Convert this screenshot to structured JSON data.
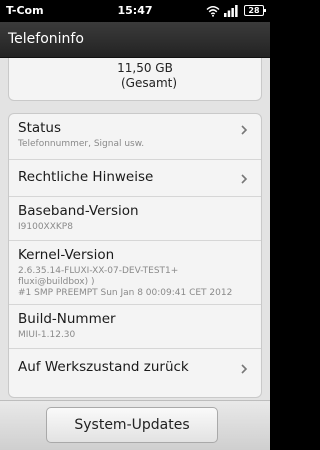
{
  "statusbar": {
    "carrier": "T-Com",
    "time": "15:47",
    "battery": "28"
  },
  "header": {
    "title": "Telefoninfo"
  },
  "storage": {
    "value": "11,50 GB",
    "label": "(Gesamt)"
  },
  "items": [
    {
      "title": "Status",
      "subtitle": "Telefonnummer, Signal usw.",
      "has_chevron": true
    },
    {
      "title": "Rechtliche Hinweise",
      "has_chevron": true
    },
    {
      "title": "Baseband-Version",
      "subtitle": "I9100XXKP8",
      "has_chevron": false
    },
    {
      "title": "Kernel-Version",
      "subtitle_lines": [
        "2.6.35.14-FLUXI-XX-07-DEV-TEST1+",
        "fluxi@buildbox) )",
        "#1 SMP PREEMPT Sun Jan 8 00:09:41 CET 2012"
      ],
      "has_chevron": false
    },
    {
      "title": "Build-Nummer",
      "subtitle": "MIUI-1.12.30",
      "has_chevron": false
    },
    {
      "title": "Auf Werkszustand zurück",
      "has_chevron": true
    }
  ],
  "bottom": {
    "button_label": "System-Updates"
  },
  "colors": {
    "background": "#e3e3e3",
    "card": "#f4f4f4",
    "titlebar": "#2e2e2e",
    "subtitle_text": "#8a8a8a"
  }
}
